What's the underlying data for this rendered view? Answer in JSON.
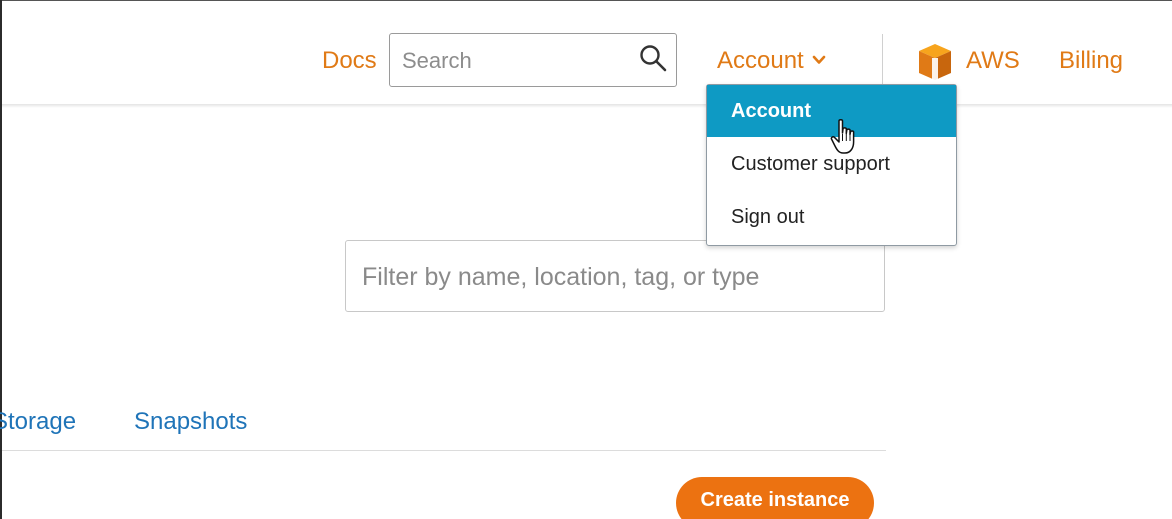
{
  "header": {
    "docs_label": "Docs",
    "search_placeholder": "Search",
    "account_label": "Account",
    "aws_label": "AWS",
    "billing_label": "Billing"
  },
  "account_menu": {
    "items": [
      {
        "label": "Account",
        "active": true
      },
      {
        "label": "Customer support",
        "active": false
      },
      {
        "label": "Sign out",
        "active": false
      }
    ]
  },
  "filter": {
    "placeholder": "Filter by name, location, tag, or type"
  },
  "tabs": [
    {
      "label": "Storage"
    },
    {
      "label": "Snapshots"
    }
  ],
  "actions": {
    "create_label": "Create instance"
  },
  "colors": {
    "accent_orange": "#e07a16",
    "button_orange": "#ec7211",
    "menu_active": "#0e9ac4",
    "tab_blue": "#1f74b8"
  },
  "icons": {
    "search": "search-icon",
    "chevron": "chevron-down-icon",
    "aws_logo": "aws-cube-logo",
    "cursor": "hand-pointer-cursor"
  }
}
